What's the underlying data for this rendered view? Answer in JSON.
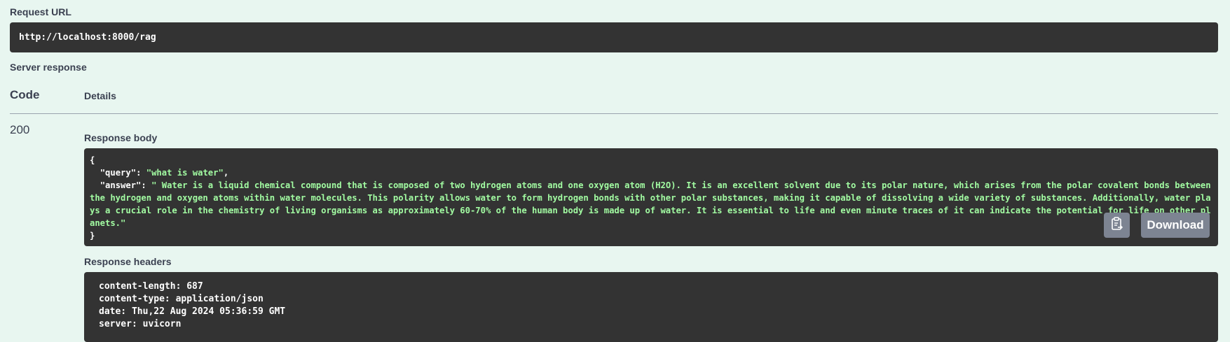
{
  "request_url": {
    "label": "Request URL",
    "value": "http://localhost:8000/rag"
  },
  "server_response": {
    "label": "Server response",
    "columns": {
      "code": "Code",
      "details": "Details"
    },
    "status_code": "200",
    "response_body": {
      "label": "Response body",
      "open_brace": "{",
      "close_brace": "}",
      "query_key": "\"query\"",
      "query_value": "\"what is water\"",
      "answer_key": "\"answer\"",
      "answer_value": "\" Water is a liquid chemical compound that is composed of two hydrogen atoms and one oxygen atom (H2O). It is an excellent solvent due to its polar nature, which arises from the polar covalent bonds between the hydrogen and oxygen atoms within water molecules. This polarity allows water to form hydrogen bonds with other polar substances, making it capable of dissolving a wide variety of substances. Additionally, water plays a crucial role in the chemistry of living organisms as approximately 60-70% of the human body is made up of water. It is essential to life and even minute traces of it can indicate the potential for life on other planets.\"",
      "copy_icon": "clipboard-copy-icon",
      "download_label": "Download"
    },
    "response_headers": {
      "label": "Response headers",
      "lines": [
        "content-length: 687",
        "content-type: application/json",
        "date: Thu,22 Aug 2024 05:36:59 GMT",
        "server: uvicorn"
      ]
    }
  }
}
